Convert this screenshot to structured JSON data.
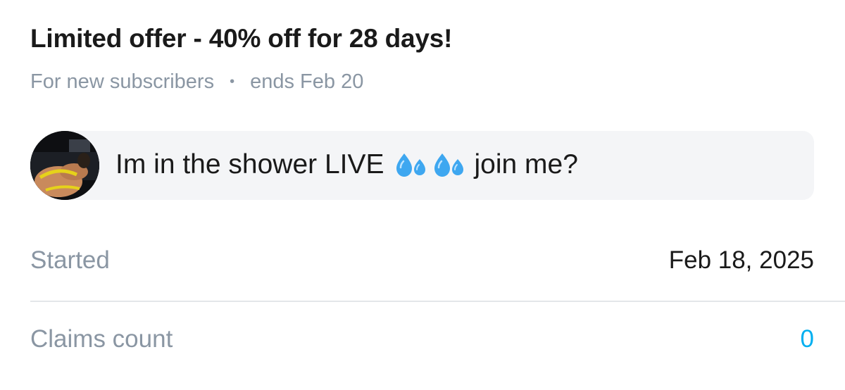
{
  "offer": {
    "title": "Limited offer - 40% off for 28 days!",
    "audience": "For new subscribers",
    "separator": "•",
    "ends": "ends Feb 20"
  },
  "message": {
    "text_before": "Im in the shower LIVE",
    "emoji": [
      "sweat-droplets-icon",
      "sweat-droplets-icon"
    ],
    "text_after": "join me?"
  },
  "details": {
    "started_label": "Started",
    "started_value": "Feb 18, 2025",
    "claims_label": "Claims count",
    "claims_value": "0"
  },
  "colors": {
    "accent": "#00aff0",
    "muted_text": "#8a96a3",
    "bubble_bg": "#f4f5f7"
  }
}
